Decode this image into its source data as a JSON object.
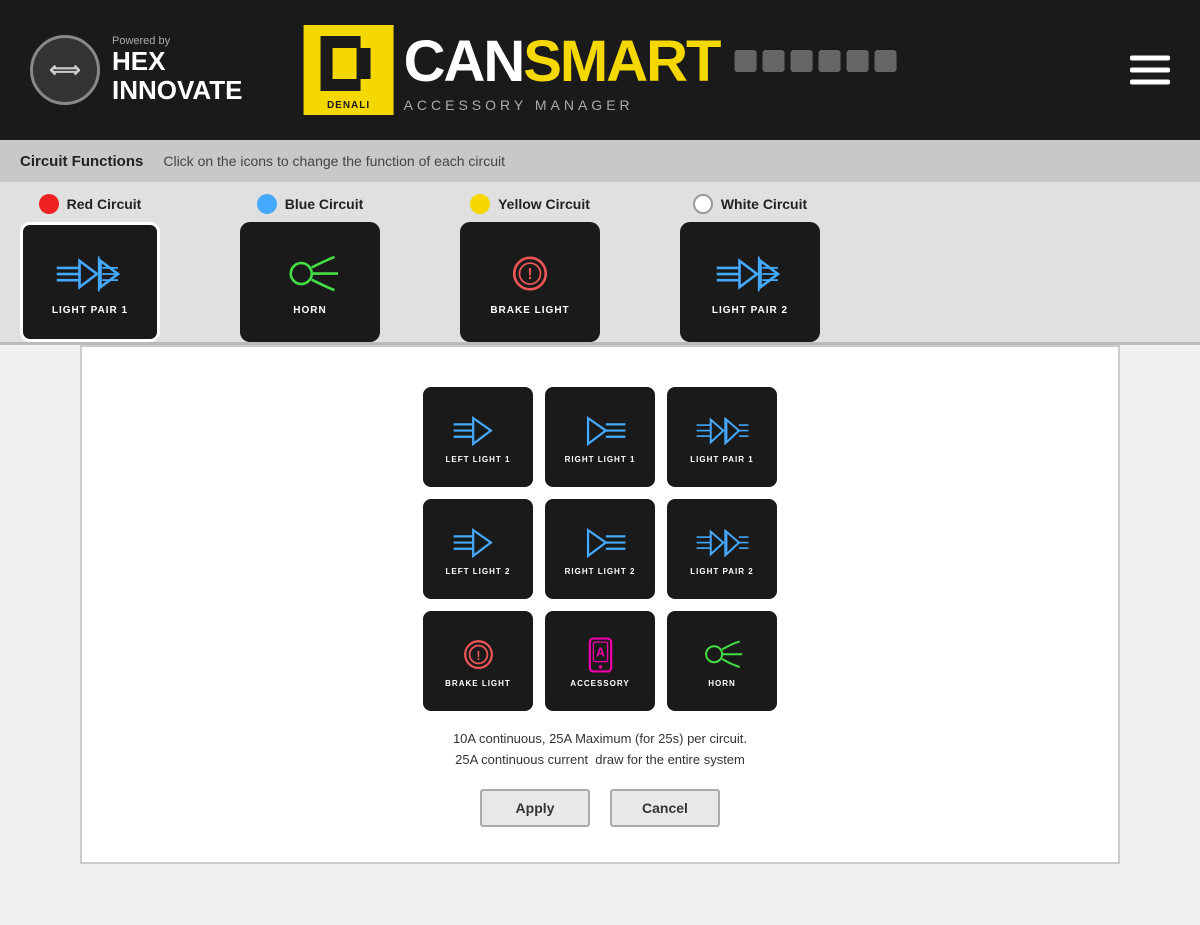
{
  "header": {
    "powered_by": "Powered by",
    "brand": "HEX\nINNOVATE",
    "can": "CAN",
    "smart": "SMART",
    "accessory_manager": "ACCESSORY MANAGER",
    "denali": "DENALI"
  },
  "circuit_bar": {
    "title": "Circuit Functions",
    "description": "Click on the icons to change the function of each circuit"
  },
  "circuits": [
    {
      "name": "Red Circuit",
      "color": "#e22",
      "type": "light_pair_1",
      "label": "LIGHT PAIR 1",
      "selected": true
    },
    {
      "name": "Blue Circuit",
      "color": "#4af",
      "type": "horn",
      "label": "HORN",
      "selected": false
    },
    {
      "name": "Yellow Circuit",
      "color": "#f5d800",
      "type": "brake_light",
      "label": "BRAKE LIGHT",
      "selected": false
    },
    {
      "name": "White Circuit",
      "color": "#fff",
      "type": "light_pair_2",
      "label": "LIGHT PAIR 2",
      "selected": false
    }
  ],
  "options": [
    {
      "id": "left_light_1",
      "label": "LEFT LIGHT 1",
      "color": "#4af"
    },
    {
      "id": "right_light_1",
      "label": "RIGHT LIGHT 1",
      "color": "#4af"
    },
    {
      "id": "light_pair_1",
      "label": "LIGHT PAIR 1",
      "color": "#4af"
    },
    {
      "id": "left_light_2",
      "label": "LEFT LIGHT 2",
      "color": "#4af"
    },
    {
      "id": "right_light_2",
      "label": "RIGHT LIGHT 2",
      "color": "#4af"
    },
    {
      "id": "light_pair_2",
      "label": "LIGHT PAIR 2",
      "color": "#4af"
    },
    {
      "id": "brake_light",
      "label": "BRAKE LIGHT",
      "color": "#e55"
    },
    {
      "id": "accessory",
      "label": "ACCESSORY",
      "color": "#e0a"
    },
    {
      "id": "horn",
      "label": "HORN",
      "color": "#4d4"
    }
  ],
  "info_text": "10A continuous, 25A Maximum (for 25s) per circuit.\n25A continuous current  draw for the entire system",
  "buttons": {
    "apply": "Apply",
    "cancel": "Cancel"
  }
}
